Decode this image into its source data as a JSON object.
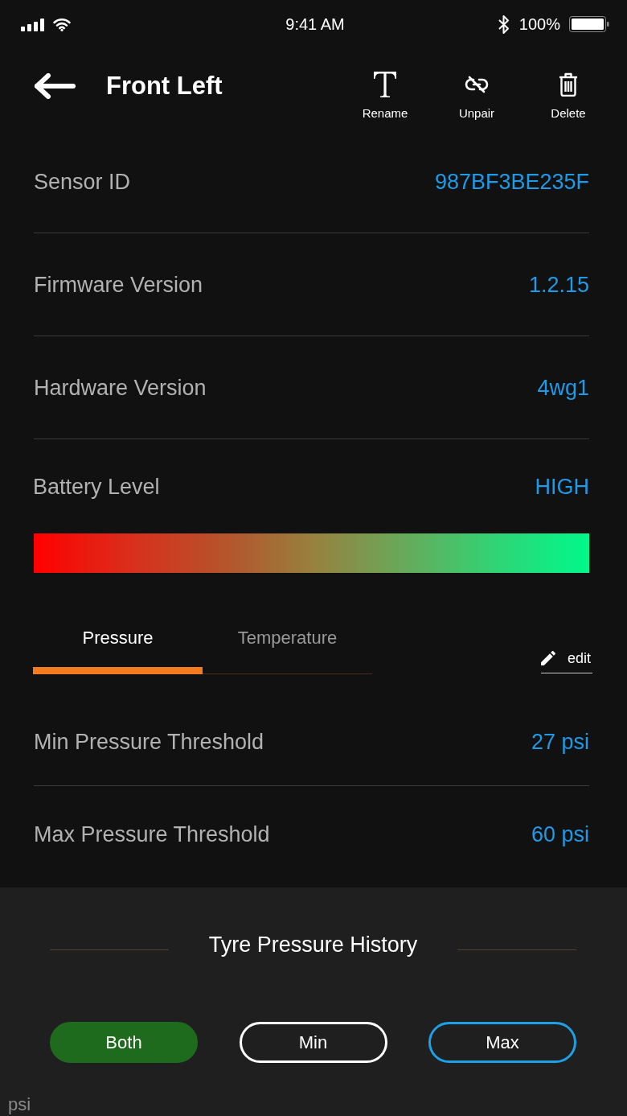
{
  "status_bar": {
    "time": "9:41 AM",
    "battery_percent": "100%"
  },
  "header": {
    "title": "Front Left",
    "actions": [
      {
        "kind": "rename",
        "label": "Rename"
      },
      {
        "kind": "unpair",
        "label": "Unpair"
      },
      {
        "kind": "delete",
        "label": "Delete"
      }
    ]
  },
  "info_rows": [
    {
      "label": "Sensor ID",
      "value": "987BF3BE235F"
    },
    {
      "label": "Firmware Version",
      "value": "1.2.15"
    },
    {
      "label": "Hardware Version",
      "value": "4wg1"
    }
  ],
  "battery": {
    "label": "Battery Level",
    "value": "HIGH"
  },
  "tabs": [
    {
      "label": "Pressure",
      "selected": true
    },
    {
      "label": "Temperature",
      "selected": false
    }
  ],
  "edit_link": {
    "label": "edit"
  },
  "thresholds": [
    {
      "label": "Min Pressure Threshold",
      "value": "27 psi"
    },
    {
      "label": "Max Pressure Threshold",
      "value": "60 psi"
    }
  ],
  "history": {
    "title": "Tyre Pressure History",
    "filters": [
      {
        "label": "Both",
        "selected": true,
        "color": "#1e6b1e"
      },
      {
        "label": "Min",
        "selected": false,
        "color": "#ffffff"
      },
      {
        "label": "Max",
        "selected": false,
        "color": "#1ea0e6"
      }
    ],
    "axis_unit": "psi"
  }
}
